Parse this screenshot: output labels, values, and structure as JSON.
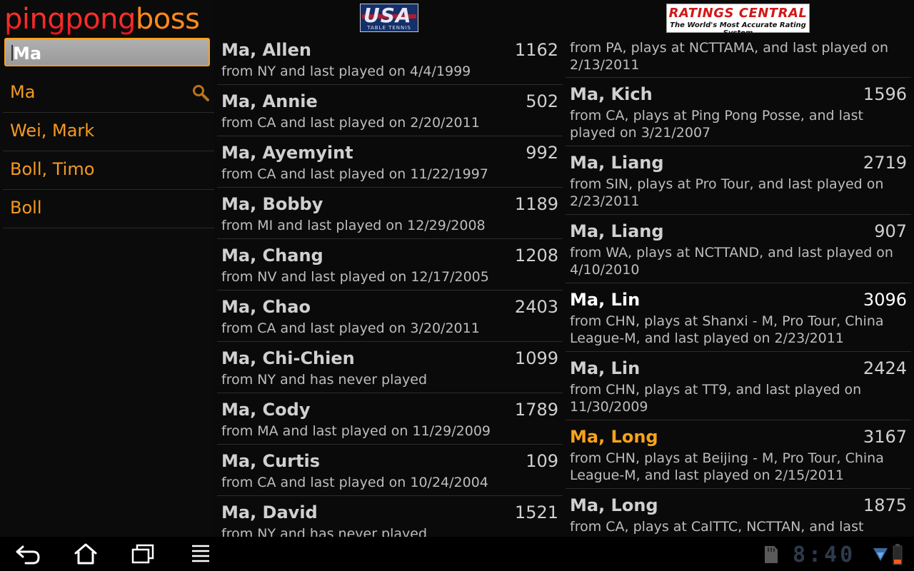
{
  "app": {
    "title_part1": "pingpong",
    "title_part2": "boss"
  },
  "search": {
    "value": "Ma"
  },
  "suggestions": [
    "Ma",
    "Wei, Mark",
    "Boll, Timo",
    "Boll"
  ],
  "logos": {
    "usa": {
      "main": "USA",
      "sub": "TABLE TENNIS"
    },
    "ratings_central": {
      "title": "RATINGS CENTRAL",
      "tagline": "The World's Most Accurate Rating System"
    }
  },
  "usatt_results": [
    {
      "name": "Ma, Allen",
      "rating": "1162",
      "desc": "from NY and last played on 4/4/1999"
    },
    {
      "name": "Ma, Annie",
      "rating": "502",
      "desc": "from CA and last played on 2/20/2011"
    },
    {
      "name": "Ma, Ayemyint",
      "rating": "992",
      "desc": "from CA and last played on 11/22/1997"
    },
    {
      "name": "Ma, Bobby",
      "rating": "1189",
      "desc": "from MI and last played on 12/29/2008"
    },
    {
      "name": "Ma, Chang",
      "rating": "1208",
      "desc": "from NV and last played on 12/17/2005"
    },
    {
      "name": "Ma, Chao",
      "rating": "2403",
      "desc": "from CA and last played on 3/20/2011"
    },
    {
      "name": "Ma, Chi-Chien",
      "rating": "1099",
      "desc": "from NY and has never played"
    },
    {
      "name": "Ma, Cody",
      "rating": "1789",
      "desc": "from MA and last played on 11/29/2009"
    },
    {
      "name": "Ma, Curtis",
      "rating": "109",
      "desc": "from CA and last played on 10/24/2004"
    },
    {
      "name": "Ma, David",
      "rating": "1521",
      "desc": "from NY and has never played"
    }
  ],
  "rc_first_desc": "from PA, plays at NCTTAMA, and last played on 2/13/2011",
  "rc_results": [
    {
      "name": "Ma, Kich",
      "rating": "1596",
      "desc": "from CA, plays at Ping Pong Posse, and last played on 3/21/2007"
    },
    {
      "name": "Ma, Liang",
      "rating": "2719",
      "desc": "from SIN, plays at Pro Tour, and last played on 2/23/2011"
    },
    {
      "name": "Ma, Liang",
      "rating": "907",
      "desc": "from WA, plays at NCTTAND, and last played on 4/10/2010"
    },
    {
      "name": "Ma, Lin",
      "rating": "3096",
      "desc": "from CHN, plays at Shanxi - M, Pro Tour, China League-M, and last played on 2/23/2011"
    },
    {
      "name": "Ma, Lin",
      "rating": "2424",
      "desc": "from CHN, plays at TT9, and last played on 11/30/2009"
    },
    {
      "name": "Ma, Long",
      "rating": "3167",
      "desc": "from CHN, plays at Beijing - M, Pro Tour, China League-M, and last played on 2/15/2011"
    },
    {
      "name": "Ma, Long",
      "rating": "1875",
      "desc": "from CA, plays at CalTTC, NCTTAN, and last played on"
    }
  ],
  "status": {
    "time": "8:40"
  },
  "colors": {
    "accent": "#f49a20",
    "focus_border": "#ffa018"
  },
  "icons": [
    "back-icon",
    "home-icon",
    "recent-apps-icon",
    "menu-icon",
    "sd-card-icon",
    "wifi-icon",
    "battery-icon",
    "search-icon"
  ]
}
